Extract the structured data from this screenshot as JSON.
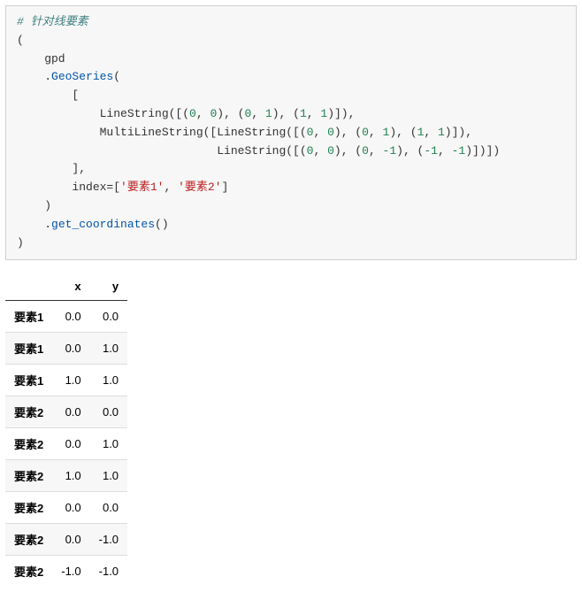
{
  "code": {
    "comment": "# 针对线要素",
    "l1": "(",
    "l2_ident": "    gpd",
    "l3_pre": "    .",
    "l3_method": "GeoSeries",
    "l3_post": "(",
    "l4": "        [",
    "l5_pre": "            LineString([(",
    "l5_n1": "0",
    "l5_c1": ", ",
    "l5_n2": "0",
    "l5_c2": "), (",
    "l5_n3": "0",
    "l5_c3": ", ",
    "l5_n4": "1",
    "l5_c4": "), (",
    "l5_n5": "1",
    "l5_c5": ", ",
    "l5_n6": "1",
    "l5_c6": ")]),",
    "l6_pre": "            MultiLineString([LineString([(",
    "l6_n1": "0",
    "l6_c1": ", ",
    "l6_n2": "0",
    "l6_c2": "), (",
    "l6_n3": "0",
    "l6_c3": ", ",
    "l6_n4": "1",
    "l6_c4": "), (",
    "l6_n5": "1",
    "l6_c5": ", ",
    "l6_n6": "1",
    "l6_c6": ")]),",
    "l7_pre": "                             LineString([(",
    "l7_n1": "0",
    "l7_c1": ", ",
    "l7_n2": "0",
    "l7_c2": "), (",
    "l7_n3": "0",
    "l7_c3": ", ",
    "l7_n4": "-1",
    "l7_c4": "), (",
    "l7_n5": "-1",
    "l7_c5": ", ",
    "l7_n6": "-1",
    "l7_c6": ")])])",
    "l8": "        ],",
    "l9_pre": "        index",
    "l9_eq": "=",
    "l9_b1": "[",
    "l9_s1": "'要素1'",
    "l9_cm": ", ",
    "l9_s2": "'要素2'",
    "l9_b2": "]",
    "l10": "    )",
    "l11_pre": "    .",
    "l11_method": "get_coordinates",
    "l11_post": "()",
    "l12": ")"
  },
  "table": {
    "col_x": "x",
    "col_y": "y",
    "rows": [
      {
        "idx": "要素1",
        "x": "0.0",
        "y": "0.0"
      },
      {
        "idx": "要素1",
        "x": "0.0",
        "y": "1.0"
      },
      {
        "idx": "要素1",
        "x": "1.0",
        "y": "1.0"
      },
      {
        "idx": "要素2",
        "x": "0.0",
        "y": "0.0"
      },
      {
        "idx": "要素2",
        "x": "0.0",
        "y": "1.0"
      },
      {
        "idx": "要素2",
        "x": "1.0",
        "y": "1.0"
      },
      {
        "idx": "要素2",
        "x": "0.0",
        "y": "0.0"
      },
      {
        "idx": "要素2",
        "x": "0.0",
        "y": "-1.0"
      },
      {
        "idx": "要素2",
        "x": "-1.0",
        "y": "-1.0"
      }
    ]
  }
}
